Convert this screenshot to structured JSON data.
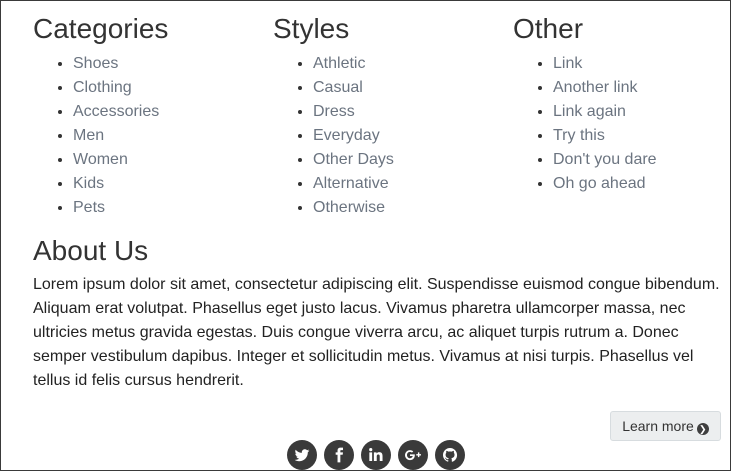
{
  "categories": {
    "heading": "Categories",
    "items": [
      "Shoes",
      "Clothing",
      "Accessories",
      "Men",
      "Women",
      "Kids",
      "Pets"
    ]
  },
  "styles": {
    "heading": "Styles",
    "items": [
      "Athletic",
      "Casual",
      "Dress",
      "Everyday",
      "Other Days",
      "Alternative",
      "Otherwise"
    ]
  },
  "other": {
    "heading": "Other",
    "items": [
      "Link",
      "Another link",
      "Link again",
      "Try this",
      "Don't you dare",
      "Oh go ahead"
    ]
  },
  "about": {
    "heading": "About Us",
    "body": "Lorem ipsum dolor sit amet, consectetur adipiscing elit. Suspendisse euismod congue bibendum. Aliquam erat volutpat. Phasellus eget justo lacus. Vivamus pharetra ullamcorper massa, nec ultricies metus gravida egestas. Duis congue viverra arcu, ac aliquet turpis rutrum a. Donec semper vestibulum dapibus. Integer et sollicitudin metus. Vivamus at nisi turpis. Phasellus vel tellus id felis cursus hendrerit."
  },
  "learn_more": {
    "label": "Learn more",
    "icon": "arrow-circle-right-icon"
  },
  "social": {
    "icons": [
      "twitter-icon",
      "facebook-icon",
      "linkedin-icon",
      "google-plus-icon",
      "github-icon"
    ],
    "background": "#3a3a3a"
  },
  "colors": {
    "link": "#6b7480",
    "heading": "#333333",
    "button_bg": "#eceeef"
  }
}
